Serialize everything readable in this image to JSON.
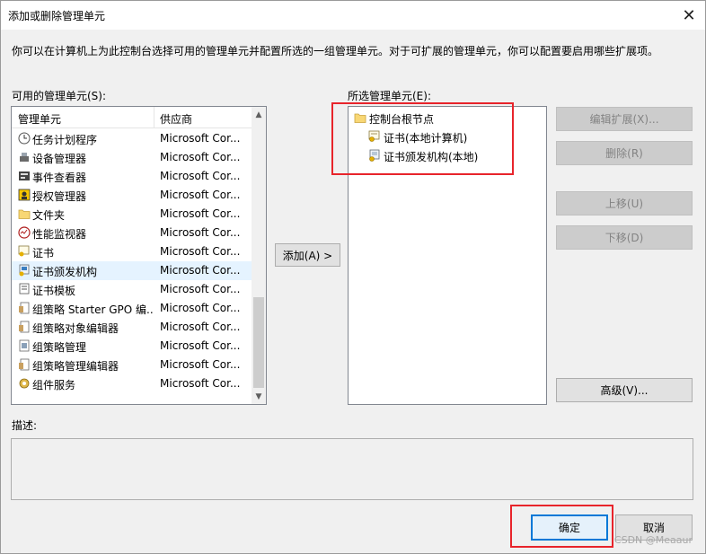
{
  "window": {
    "title": "添加或删除管理单元",
    "close_glyph": "✕"
  },
  "intro_text": "你可以在计算机上为此控制台选择可用的管理单元并配置所选的一组管理单元。对于可扩展的管理单元，你可以配置要启用哪些扩展项。",
  "available": {
    "label": "可用的管理单元(S):",
    "columns": [
      "管理单元",
      "供应商"
    ],
    "items": [
      {
        "name": "任务计划程序",
        "vendor": "Microsoft Cor...",
        "icon": "clock-icon"
      },
      {
        "name": "设备管理器",
        "vendor": "Microsoft Cor...",
        "icon": "device-manager-icon"
      },
      {
        "name": "事件查看器",
        "vendor": "Microsoft Cor...",
        "icon": "event-viewer-icon"
      },
      {
        "name": "授权管理器",
        "vendor": "Microsoft Cor...",
        "icon": "authorization-icon"
      },
      {
        "name": "文件夹",
        "vendor": "Microsoft Cor...",
        "icon": "folder-icon"
      },
      {
        "name": "性能监视器",
        "vendor": "Microsoft Cor...",
        "icon": "performance-icon"
      },
      {
        "name": "证书",
        "vendor": "Microsoft Cor...",
        "icon": "certificate-icon"
      },
      {
        "name": "证书颁发机构",
        "vendor": "Microsoft Cor...",
        "icon": "certificate-authority-icon"
      },
      {
        "name": "证书模板",
        "vendor": "Microsoft Cor...",
        "icon": "certificate-template-icon"
      },
      {
        "name": "组策略 Starter GPO 编...",
        "vendor": "Microsoft Cor...",
        "icon": "policy-icon"
      },
      {
        "name": "组策略对象编辑器",
        "vendor": "Microsoft Cor...",
        "icon": "policy-icon"
      },
      {
        "name": "组策略管理",
        "vendor": "Microsoft Cor...",
        "icon": "policy-management-icon"
      },
      {
        "name": "组策略管理编辑器",
        "vendor": "Microsoft Cor...",
        "icon": "policy-icon"
      },
      {
        "name": "组件服务",
        "vendor": "Microsoft Cor...",
        "icon": "component-services-icon"
      }
    ],
    "selected_item": "证书颁发机构"
  },
  "add_button": "添加(A) >",
  "selected": {
    "label": "所选管理单元(E):",
    "root": "控制台根节点",
    "children": [
      "证书(本地计算机)",
      "证书颁发机构(本地)"
    ]
  },
  "side_buttons": {
    "edit_extensions": "编辑扩展(X)...",
    "remove": "删除(R)",
    "move_up": "上移(U)",
    "move_down": "下移(D)",
    "advanced": "高级(V)..."
  },
  "description_label": "描述:",
  "footer": {
    "ok": "确定",
    "cancel": "取消"
  },
  "watermark": "CSDN @Meaaur",
  "colors": {
    "highlight_box": "#e8242b",
    "default_button_border": "#0078d7",
    "selection": "#e5f3ff"
  }
}
